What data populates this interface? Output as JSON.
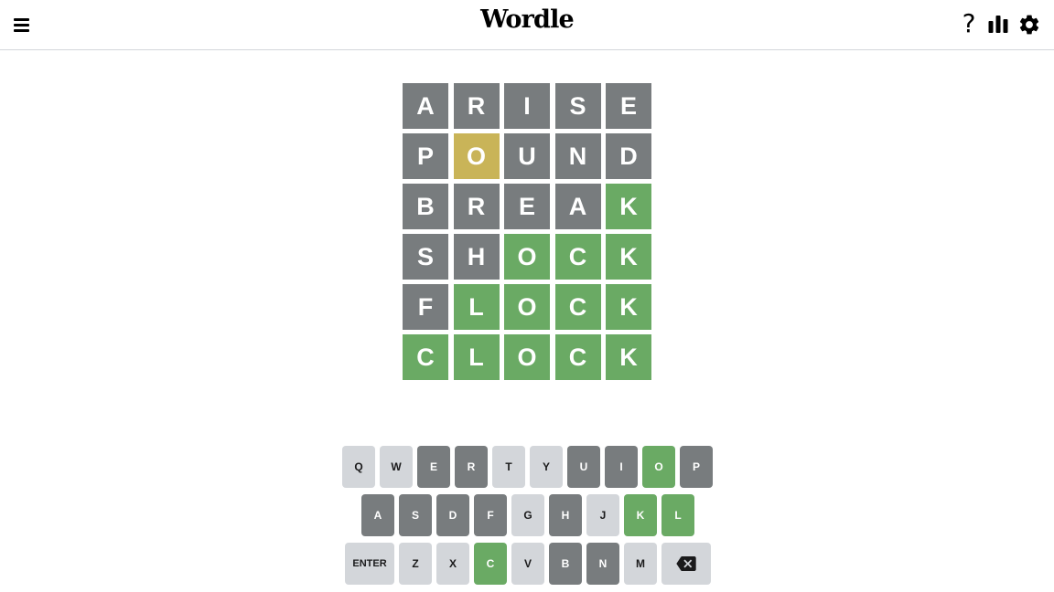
{
  "header": {
    "title": "Wordle",
    "menu_icon": "hamburger-menu-icon",
    "help_icon": "question-mark-icon",
    "help_label": "?",
    "stats_icon": "bar-chart-icon",
    "settings_icon": "gear-icon"
  },
  "colors": {
    "absent": "#787c7e",
    "present": "#c9b458",
    "correct": "#6aaa64",
    "unused_key": "#d3d6da"
  },
  "board": {
    "rows": [
      {
        "tiles": [
          {
            "letter": "A",
            "state": "absent"
          },
          {
            "letter": "R",
            "state": "absent"
          },
          {
            "letter": "I",
            "state": "absent"
          },
          {
            "letter": "S",
            "state": "absent"
          },
          {
            "letter": "E",
            "state": "absent"
          }
        ]
      },
      {
        "tiles": [
          {
            "letter": "P",
            "state": "absent"
          },
          {
            "letter": "O",
            "state": "present"
          },
          {
            "letter": "U",
            "state": "absent"
          },
          {
            "letter": "N",
            "state": "absent"
          },
          {
            "letter": "D",
            "state": "absent"
          }
        ]
      },
      {
        "tiles": [
          {
            "letter": "B",
            "state": "absent"
          },
          {
            "letter": "R",
            "state": "absent"
          },
          {
            "letter": "E",
            "state": "absent"
          },
          {
            "letter": "A",
            "state": "absent"
          },
          {
            "letter": "K",
            "state": "correct"
          }
        ]
      },
      {
        "tiles": [
          {
            "letter": "S",
            "state": "absent"
          },
          {
            "letter": "H",
            "state": "absent"
          },
          {
            "letter": "O",
            "state": "correct"
          },
          {
            "letter": "C",
            "state": "correct"
          },
          {
            "letter": "K",
            "state": "correct"
          }
        ]
      },
      {
        "tiles": [
          {
            "letter": "F",
            "state": "absent"
          },
          {
            "letter": "L",
            "state": "correct"
          },
          {
            "letter": "O",
            "state": "correct"
          },
          {
            "letter": "C",
            "state": "correct"
          },
          {
            "letter": "K",
            "state": "correct"
          }
        ]
      },
      {
        "tiles": [
          {
            "letter": "C",
            "state": "correct"
          },
          {
            "letter": "L",
            "state": "correct"
          },
          {
            "letter": "O",
            "state": "correct"
          },
          {
            "letter": "C",
            "state": "correct"
          },
          {
            "letter": "K",
            "state": "correct"
          }
        ]
      }
    ]
  },
  "keyboard": {
    "rows": [
      [
        {
          "label": "Q",
          "state": "unused"
        },
        {
          "label": "W",
          "state": "unused"
        },
        {
          "label": "E",
          "state": "absent"
        },
        {
          "label": "R",
          "state": "absent"
        },
        {
          "label": "T",
          "state": "unused"
        },
        {
          "label": "Y",
          "state": "unused"
        },
        {
          "label": "U",
          "state": "absent"
        },
        {
          "label": "I",
          "state": "absent"
        },
        {
          "label": "O",
          "state": "correct"
        },
        {
          "label": "P",
          "state": "absent"
        }
      ],
      [
        {
          "label": "A",
          "state": "absent"
        },
        {
          "label": "S",
          "state": "absent"
        },
        {
          "label": "D",
          "state": "absent"
        },
        {
          "label": "F",
          "state": "absent"
        },
        {
          "label": "G",
          "state": "unused"
        },
        {
          "label": "H",
          "state": "absent"
        },
        {
          "label": "J",
          "state": "unused"
        },
        {
          "label": "K",
          "state": "correct"
        },
        {
          "label": "L",
          "state": "correct"
        }
      ],
      [
        {
          "label": "ENTER",
          "state": "unused",
          "wide": true
        },
        {
          "label": "Z",
          "state": "unused"
        },
        {
          "label": "X",
          "state": "unused"
        },
        {
          "label": "C",
          "state": "correct"
        },
        {
          "label": "V",
          "state": "unused"
        },
        {
          "label": "B",
          "state": "absent"
        },
        {
          "label": "N",
          "state": "absent"
        },
        {
          "label": "M",
          "state": "unused"
        },
        {
          "label": "",
          "icon": "backspace-icon",
          "state": "unused",
          "wide": true
        }
      ]
    ]
  }
}
